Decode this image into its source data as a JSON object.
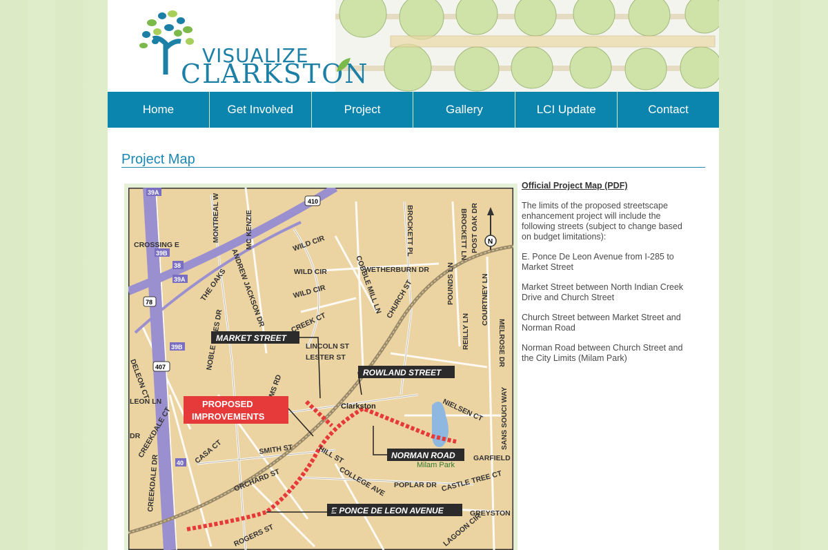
{
  "logo": {
    "line1": "VISUALIZE",
    "line2": "CLARKSTON"
  },
  "nav": [
    "Home",
    "Get Involved",
    "Project",
    "Gallery",
    "LCI Update",
    "Contact"
  ],
  "page_title": "Project Map",
  "sidebar": {
    "pdf_link": "Official Project Map (PDF)",
    "intro": "The limits of the proposed streetscape enhancement project will include the following streets (subject to change based on budget limitations):",
    "streets": [
      "E. Ponce De Leon Avenue from I-285 to Market Street",
      "Market Street between North Indian Creek Drive and Church Street",
      "Church Street between Market Street and Norman Road",
      "Norman Road between Church Street and the City Limits (Milam Park)"
    ]
  },
  "map": {
    "callouts": {
      "market": "MARKET STREET",
      "rowland": "ROWLAND STREET",
      "norman": "NORMAN ROAD",
      "ponce": "E PONCE DE LEON AVENUE",
      "proposed_1": "PROPOSED",
      "proposed_2": "IMPROVEMENTS"
    },
    "labels": {
      "clarkston": "Clarkston",
      "milam": "Milam Park",
      "wild_cir_1": "WILD CIR",
      "wild_cir_2": "WILD CIR",
      "wild_cir_3": "WILD CIR",
      "wetherburn": "WETHERBURN DR",
      "church": "CHURCH ST",
      "lincoln": "LINCOLN ST",
      "lester": "LESTER ST",
      "smith": "SMITH ST",
      "orchard": "ORCHARD ST",
      "poplar": "POPLAR DR",
      "castle": "CASTLE TREE CT",
      "garfield": "GARFIELD",
      "greyston": "GREYSTON",
      "rogers": "ROGERS ST",
      "crossing": "CROSSING E",
      "nielsen": "NIELSEN CT",
      "creek_ct": "CREEK CT",
      "college": "COLLEGE AVE",
      "hill": "HILL ST",
      "casa": "CASA CT",
      "leon_ln": "LEON LN",
      "dr": "DR",
      "pounds": "POUNDS LN",
      "reilly": "REILLY LN",
      "courtney": "COURTNEY LN",
      "brockett_pl": "BROCKETT PL",
      "brockett_ln": "BROCKETT LN",
      "post_oak": "POST OAK DR",
      "melrose": "MELROSE DR",
      "sans_souci": "SANS SOUCI WAY",
      "montreal": "MONTREAL W",
      "mc_kenzie": "MC KENZIE",
      "cobble": "COBBLE MILL LN",
      "the_oaks": "THE OAKS",
      "andrew": "ANDREW JACKSON DR",
      "noble": "NOBLE VINES DR",
      "sams": "SAMS RD",
      "creekdale": "CREEKDALE DR",
      "creekdale_ct": "CREEKDALE CT",
      "deleon": "DELEON CT",
      "lagoon": "LAGOON CIR",
      "rte410": "410",
      "rte78": "78",
      "rte407": "407",
      "exit39a": "39A",
      "exit39b": "39B",
      "exit38": "38",
      "exit40": "40",
      "north": "N"
    }
  }
}
